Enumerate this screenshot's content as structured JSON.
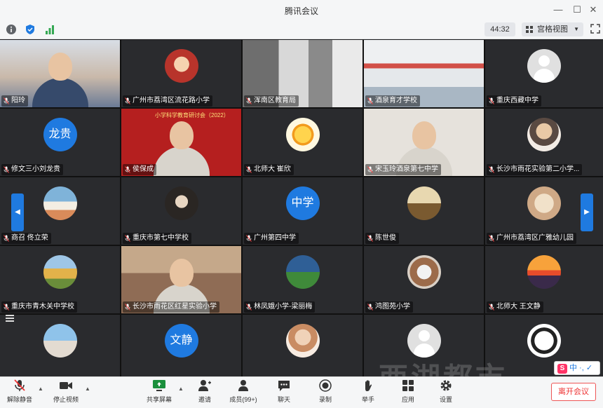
{
  "window": {
    "title": "腾讯会议"
  },
  "infobar": {
    "timer": "44:32",
    "view_label": "宫格视图"
  },
  "tiles": [
    {
      "name": "阳玲"
    },
    {
      "name": "广州市荔湾区流花路小学"
    },
    {
      "name": "浑南区教育局"
    },
    {
      "name": "酒泉育才学校"
    },
    {
      "name": "重庆西藏中学"
    },
    {
      "name": "修文三小刘龙贵",
      "avatar_text": "龙贵"
    },
    {
      "name": "侯保成",
      "banner_text": "小学科学教育研讨会（2022）"
    },
    {
      "name": "北师大 崔欣"
    },
    {
      "name": "宋玉玲酒泉第七中学"
    },
    {
      "name": "长沙市雨花实验第二小学..."
    },
    {
      "name": "商召 佟立荣"
    },
    {
      "name": "重庆市第七中学校"
    },
    {
      "name": "广州第四中学",
      "avatar_text": "中学"
    },
    {
      "name": "陈世俊"
    },
    {
      "name": "广州市荔湾区广雅幼儿园"
    },
    {
      "name": "重庆市青木关中学校"
    },
    {
      "name": "长沙市雨花区红星实验小学"
    },
    {
      "name": "林凤娥小学-梁丽梅"
    },
    {
      "name": "鸿图苑小学"
    },
    {
      "name": "北师大 王文静"
    },
    {
      "name": ""
    },
    {
      "name": "",
      "avatar_text": "文静"
    },
    {
      "name": ""
    },
    {
      "name": ""
    },
    {
      "name": ""
    }
  ],
  "toolbar": {
    "mute": "解除静音",
    "video": "停止视频",
    "share": "共享屏幕",
    "invite": "邀请",
    "members": "成员(99+)",
    "chat": "聊天",
    "record": "录制",
    "raise_hand": "举手",
    "apps": "应用",
    "settings": "设置",
    "leave": "离开会议"
  },
  "ime": {
    "logo": "S",
    "text": "中 ·, ✓"
  },
  "watermark": "西湖都市"
}
